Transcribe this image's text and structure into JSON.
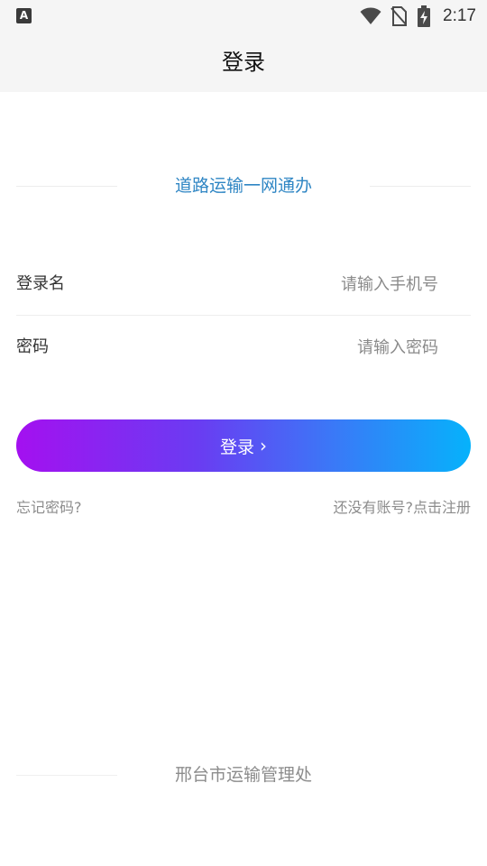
{
  "status_bar": {
    "notification_icon": "a-icon",
    "wifi_icon": "wifi-icon",
    "sim_icon": "no-sim-icon",
    "battery_icon": "battery-charging-icon",
    "time": "2:17"
  },
  "header": {
    "title": "登录"
  },
  "brand": {
    "text": "道路运输一网通办",
    "color": "#2f86c4"
  },
  "form": {
    "username": {
      "label": "登录名",
      "placeholder": "请输入手机号",
      "value": ""
    },
    "password": {
      "label": "密码",
      "placeholder": "请输入密码",
      "value": ""
    }
  },
  "login_button": {
    "label": "登录",
    "arrow": "›",
    "gradient_start": "#a410f0",
    "gradient_end": "#06b2fb"
  },
  "links": {
    "forgot_password": "忘记密码?",
    "register": "还没有账号?点击注册"
  },
  "footer": {
    "text": "邢台市运输管理处"
  }
}
